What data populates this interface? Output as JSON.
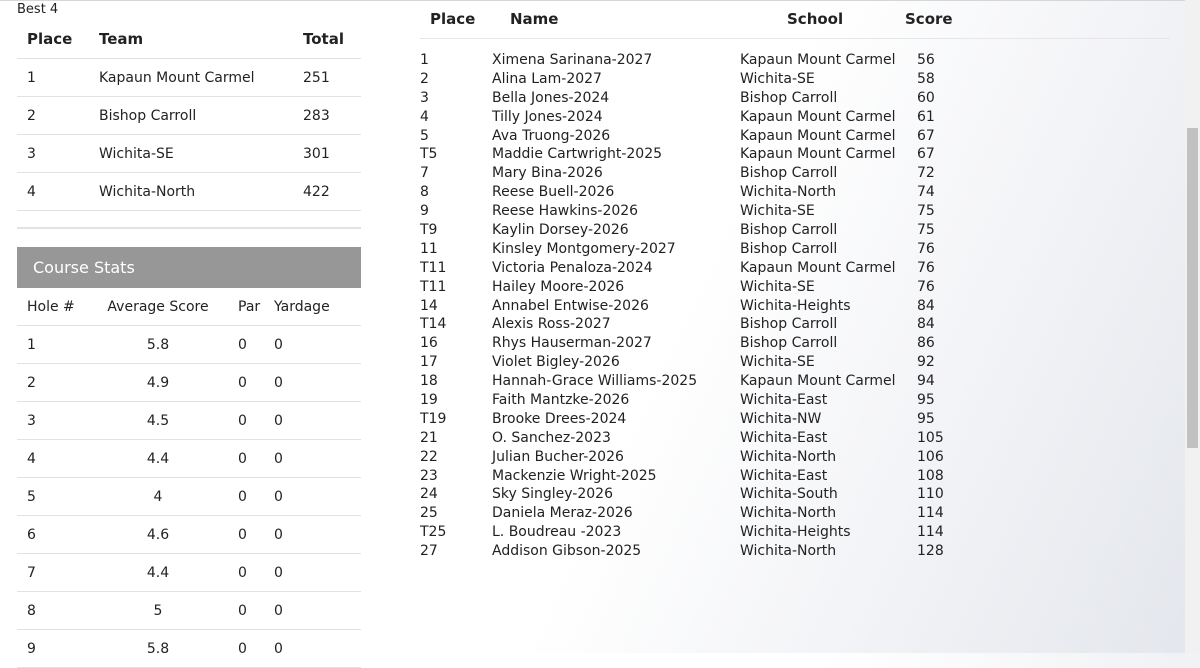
{
  "best_label": "Best 4",
  "team_table": {
    "headers": {
      "place": "Place",
      "team": "Team",
      "total": "Total"
    },
    "rows": [
      {
        "place": "1",
        "team": "Kapaun Mount Carmel",
        "total": "251"
      },
      {
        "place": "2",
        "team": "Bishop Carroll",
        "total": "283"
      },
      {
        "place": "3",
        "team": "Wichita-SE",
        "total": "301"
      },
      {
        "place": "4",
        "team": "Wichita-North",
        "total": "422"
      }
    ]
  },
  "course_stats": {
    "title": "Course Stats",
    "headers": {
      "hole": "Hole #",
      "avg": "Average Score",
      "par": "Par",
      "yardage": "Yardage"
    },
    "rows": [
      {
        "hole": "1",
        "avg": "5.8",
        "par": "0",
        "yardage": "0"
      },
      {
        "hole": "2",
        "avg": "4.9",
        "par": "0",
        "yardage": "0"
      },
      {
        "hole": "3",
        "avg": "4.5",
        "par": "0",
        "yardage": "0"
      },
      {
        "hole": "4",
        "avg": "4.4",
        "par": "0",
        "yardage": "0"
      },
      {
        "hole": "5",
        "avg": "4",
        "par": "0",
        "yardage": "0"
      },
      {
        "hole": "6",
        "avg": "4.6",
        "par": "0",
        "yardage": "0"
      },
      {
        "hole": "7",
        "avg": "4.4",
        "par": "0",
        "yardage": "0"
      },
      {
        "hole": "8",
        "avg": "5",
        "par": "0",
        "yardage": "0"
      },
      {
        "hole": "9",
        "avg": "5.8",
        "par": "0",
        "yardage": "0"
      }
    ]
  },
  "individual": {
    "headers": {
      "place": "Place",
      "name": "Name",
      "school": "School",
      "score": "Score"
    },
    "rows": [
      {
        "place": "1",
        "name": "Ximena Sarinana-2027",
        "school": "Kapaun Mount Carmel",
        "score": "56"
      },
      {
        "place": "2",
        "name": "Alina Lam-2027",
        "school": "Wichita-SE",
        "score": "58"
      },
      {
        "place": "3",
        "name": "Bella Jones-2024",
        "school": "Bishop Carroll",
        "score": "60"
      },
      {
        "place": "4",
        "name": "Tilly Jones-2024",
        "school": "Kapaun Mount Carmel",
        "score": "61"
      },
      {
        "place": "5",
        "name": "Ava Truong-2026",
        "school": "Kapaun Mount Carmel",
        "score": "67"
      },
      {
        "place": "T5",
        "name": "Maddie Cartwright-2025",
        "school": "Kapaun Mount Carmel",
        "score": "67"
      },
      {
        "place": "7",
        "name": "Mary Bina-2026",
        "school": "Bishop Carroll",
        "score": "72"
      },
      {
        "place": "8",
        "name": "Reese Buell-2026",
        "school": "Wichita-North",
        "score": "74"
      },
      {
        "place": "9",
        "name": "Reese Hawkins-2026",
        "school": "Wichita-SE",
        "score": "75"
      },
      {
        "place": "T9",
        "name": "Kaylin Dorsey-2026",
        "school": "Bishop Carroll",
        "score": "75"
      },
      {
        "place": "11",
        "name": "Kinsley Montgomery-2027",
        "school": "Bishop Carroll",
        "score": "76"
      },
      {
        "place": "T11",
        "name": "Victoria Penaloza-2024",
        "school": "Kapaun Mount Carmel",
        "score": "76"
      },
      {
        "place": "T11",
        "name": "Hailey Moore-2026",
        "school": "Wichita-SE",
        "score": "76"
      },
      {
        "place": "14",
        "name": "Annabel Entwise-2026",
        "school": "Wichita-Heights",
        "score": "84"
      },
      {
        "place": "T14",
        "name": "Alexis Ross-2027",
        "school": "Bishop Carroll",
        "score": "84"
      },
      {
        "place": "16",
        "name": "Rhys Hauserman-2027",
        "school": "Bishop Carroll",
        "score": "86"
      },
      {
        "place": "17",
        "name": "Violet Bigley-2026",
        "school": "Wichita-SE",
        "score": "92"
      },
      {
        "place": "18",
        "name": "Hannah-Grace Williams-2025",
        "school": "Kapaun Mount Carmel",
        "score": "94"
      },
      {
        "place": "19",
        "name": "Faith Mantzke-2026",
        "school": "Wichita-East",
        "score": "95"
      },
      {
        "place": "T19",
        "name": "Brooke Drees-2024",
        "school": "Wichita-NW",
        "score": "95"
      },
      {
        "place": "21",
        "name": "O. Sanchez-2023",
        "school": "Wichita-East",
        "score": "105"
      },
      {
        "place": "22",
        "name": "Julian Bucher-2026",
        "school": "Wichita-North",
        "score": "106"
      },
      {
        "place": "23",
        "name": "Mackenzie Wright-2025",
        "school": "Wichita-East",
        "score": "108"
      },
      {
        "place": "24",
        "name": "Sky Singley-2026",
        "school": "Wichita-South",
        "score": "110"
      },
      {
        "place": "25",
        "name": "Daniela Meraz-2026",
        "school": "Wichita-North",
        "score": "114"
      },
      {
        "place": "T25",
        "name": "L. Boudreau -2023",
        "school": "Wichita-Heights",
        "score": "114"
      },
      {
        "place": "27",
        "name": "Addison Gibson-2025",
        "school": "Wichita-North",
        "score": "128"
      }
    ]
  }
}
